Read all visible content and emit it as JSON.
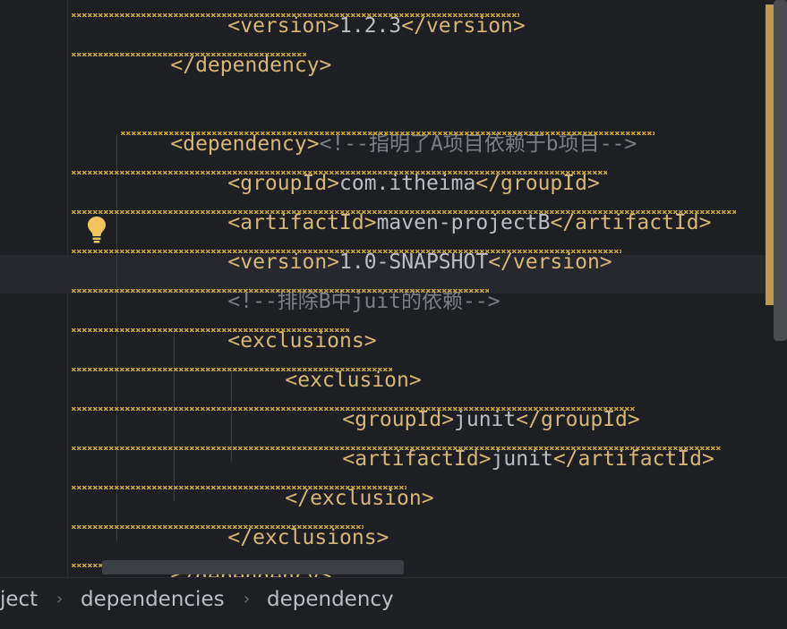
{
  "code_lines": [
    "<version>1.2.3</version>",
    "</dependency>",
    "<dependency><!--指明了A项目依赖于b项目-->",
    "<groupId>com.itheima</groupId>",
    "<artifactId>maven-projectB</artifactId>",
    "<version>1.0-SNAPSHOT</version>",
    "<!--排除B中juit的依赖-->",
    "<exclusions>",
    "<exclusion>",
    "<groupId>junit</groupId>",
    "<artifactId>junit</artifactId>",
    "</exclusion>",
    "</exclusions>",
    "</dependency>"
  ],
  "lines": {
    "l0": {
      "open": "<version>",
      "text": "1.2.3",
      "close": "</version>"
    },
    "l1": {
      "close": "</dependency>"
    },
    "l2": {
      "open": "<dependency>",
      "comment": "<!--指明了A项目依赖于b项目-->"
    },
    "l3": {
      "open": "<groupId>",
      "text": "com.itheima",
      "close": "</groupId>"
    },
    "l4": {
      "open": "<artifactId>",
      "text": "maven-projectB",
      "close": "</artifactId>"
    },
    "l5": {
      "open": "<version>",
      "text": "1.0-SNAPSHOT",
      "close": "</version>"
    },
    "l6": {
      "comment": "<!--排除B中juit的依赖-->"
    },
    "l7": {
      "open": "<exclusions>"
    },
    "l8": {
      "open": "<exclusion>"
    },
    "l9": {
      "open": "<groupId>",
      "text": "junit",
      "close": "</groupId>"
    },
    "l10": {
      "open": "<artifactId>",
      "text": "junit",
      "close": "</artifactId>"
    },
    "l11": {
      "close": "</exclusion>"
    },
    "l12": {
      "close": "</exclusions>"
    },
    "l13": {
      "close": "</dependency>"
    }
  },
  "breadcrumbs": [
    "ject",
    "dependencies",
    "dependency"
  ],
  "icons": {
    "intention": "lightbulb-icon",
    "separator": "chevron-right-icon"
  },
  "colors": {
    "tag": "#d5b778",
    "text": "#bcbec4",
    "comment": "#7a7e85",
    "warning_squiggle": "#c9a739",
    "background": "#1e1f22"
  }
}
